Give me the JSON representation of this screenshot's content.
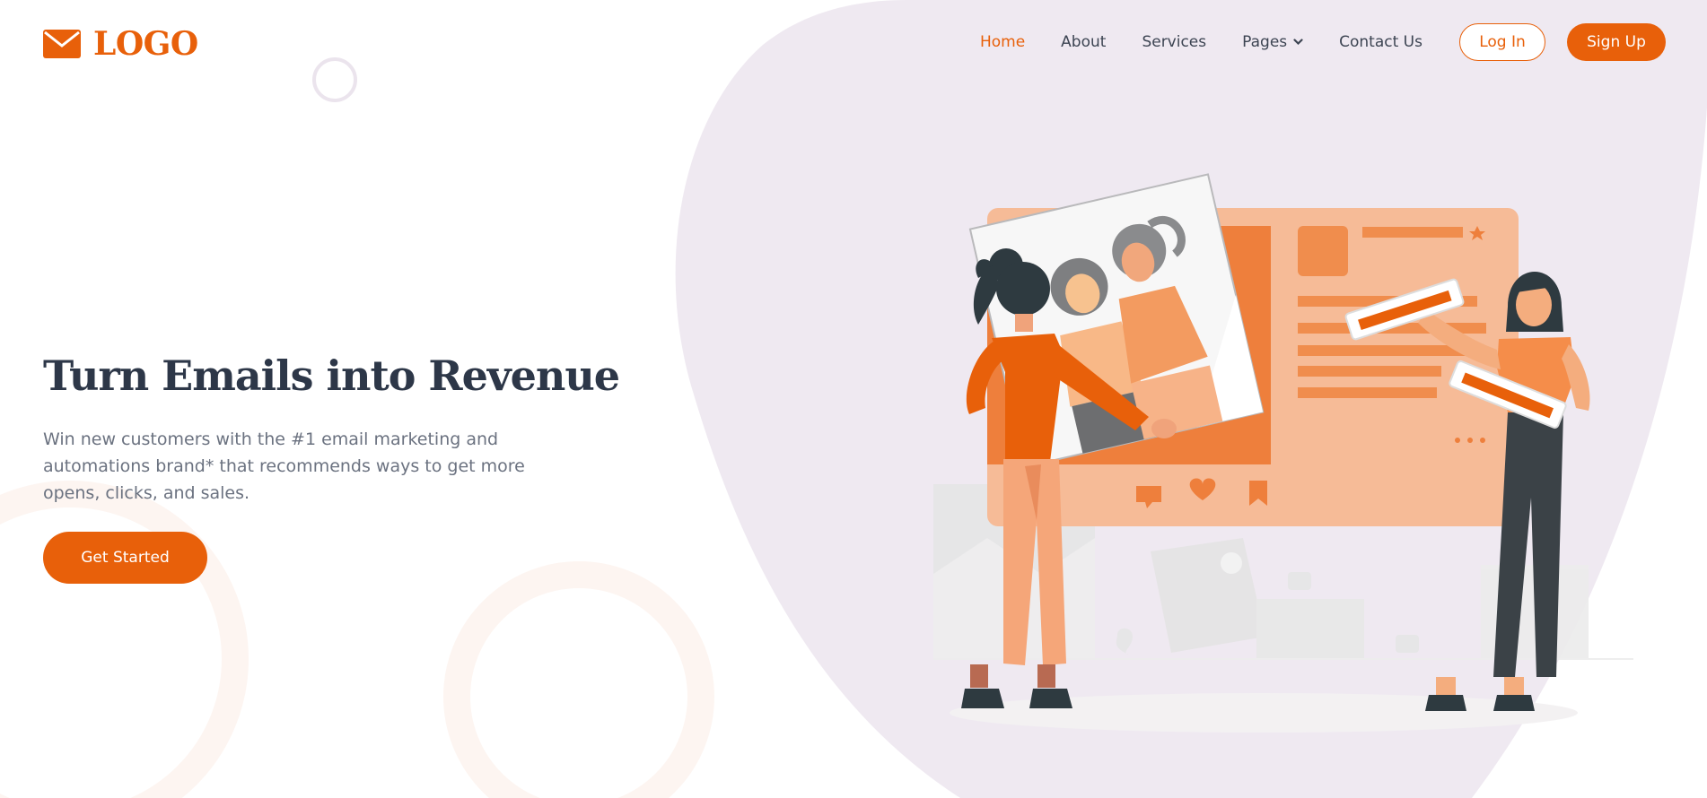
{
  "brand": {
    "logo_text": "LOGO",
    "accent_color": "#e8600a",
    "logo_icon": "envelope-icon"
  },
  "nav": {
    "items": [
      {
        "label": "Home",
        "active": true
      },
      {
        "label": "About",
        "active": false
      },
      {
        "label": "Services",
        "active": false
      },
      {
        "label": "Pages",
        "active": false,
        "has_dropdown": true
      },
      {
        "label": "Contact Us",
        "active": false
      }
    ],
    "login_label": "Log In",
    "signup_label": "Sign Up"
  },
  "hero": {
    "title": "Turn Emails into Revenue",
    "subtitle": "Win new customers with the #1 email marketing and automations brand* that recommends ways to get more opens, clicks, and sales.",
    "cta_label": "Get Started"
  },
  "colors": {
    "blob": "#efe9f1",
    "heading": "#2d3748",
    "body_text": "#6b7280",
    "nav_text": "#3c4452"
  },
  "illustration": {
    "icon_names": [
      "comment-icon",
      "heart-icon",
      "bookmark-icon",
      "star-icon"
    ]
  }
}
